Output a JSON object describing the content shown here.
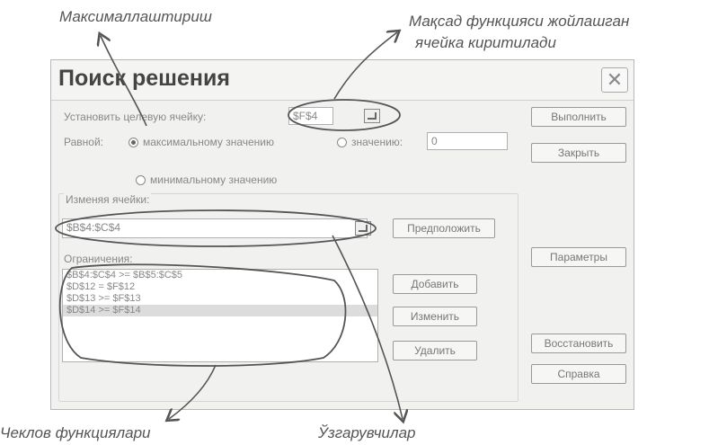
{
  "annotations": {
    "maximize": "Максималлаштириш",
    "target_line1": "Мақсад функцияси жойлашган",
    "target_line2": "ячейка киритилади",
    "constraints": "Чеклов функциялари",
    "variables": "Ўзгарувчилар"
  },
  "dialog": {
    "title": "Поиск решения",
    "close_symbol": "✕",
    "target_label": "Установить целевую ячейку:",
    "target_value": "$F$4",
    "equal_label": "Равной:",
    "radio_max": "максимальному значению",
    "radio_value": "значению:",
    "value_field": "0",
    "radio_min": "минимальному значению",
    "changing_label": "Изменяя ячейки:",
    "changing_value": "$B$4:$C$4",
    "guess_button": "Предположить",
    "constraints_label": "Ограничения:",
    "constraints": [
      "$B$4:$C$4 >= $B$5:$C$5",
      "$D$12 = $F$12",
      "$D$13 >= $F$13",
      "$D$14 >= $F$14"
    ],
    "buttons": {
      "solve": "Выполнить",
      "close": "Закрыть",
      "options": "Параметры",
      "add": "Добавить",
      "change": "Изменить",
      "delete": "Удалить",
      "reset": "Восстановить",
      "help": "Справка"
    }
  }
}
